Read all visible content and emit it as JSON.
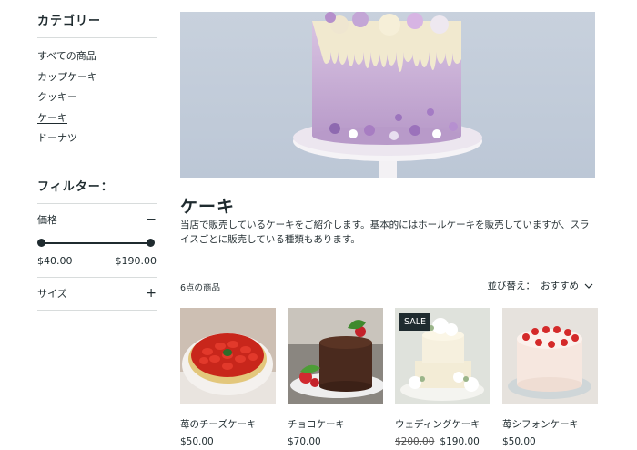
{
  "sidebar": {
    "category_heading": "カテゴリー",
    "categories": [
      {
        "label": "すべての商品"
      },
      {
        "label": "カップケーキ"
      },
      {
        "label": "クッキー"
      },
      {
        "label": "ケーキ"
      },
      {
        "label": "ドーナツ"
      }
    ],
    "active_category": "ケーキ",
    "filter_heading": "フィルター：",
    "price_filter": {
      "label": "価格",
      "toggle": "−",
      "min": "$40.00",
      "max": "$190.00",
      "range_low_fraction": 0.0,
      "range_high_fraction": 1.0
    },
    "size_filter": {
      "label": "サイズ",
      "toggle": "+"
    }
  },
  "main": {
    "title": "ケーキ",
    "description": "当店で販売しているケーキをご紹介します。基本的にはホールケーキを販売していますが、スライスごとに販売している種類もあります。",
    "count": "6点の商品",
    "sort": {
      "label": "並び替え：",
      "value": "おすすめ"
    }
  },
  "products": [
    {
      "name": "苺のチーズケーキ",
      "price": "$50.00",
      "old_price": "",
      "badge": "",
      "image": "strawberry-tart"
    },
    {
      "name": "チョコケーキ",
      "price": "$70.00",
      "old_price": "",
      "badge": "",
      "image": "chocolate-cake"
    },
    {
      "name": "ウェディングケーキ",
      "price": "$190.00",
      "old_price": "$200.00",
      "badge": "SALE",
      "image": "wedding-cake"
    },
    {
      "name": "苺シフォンケーキ",
      "price": "$50.00",
      "old_price": "",
      "badge": "",
      "image": "chiffon-cake"
    }
  ],
  "colors": {
    "text": "#1f2b2f",
    "badge_bg": "#1f2b2f",
    "divider": "#d8dcdc",
    "hero_bg": "#c8d1dd"
  }
}
